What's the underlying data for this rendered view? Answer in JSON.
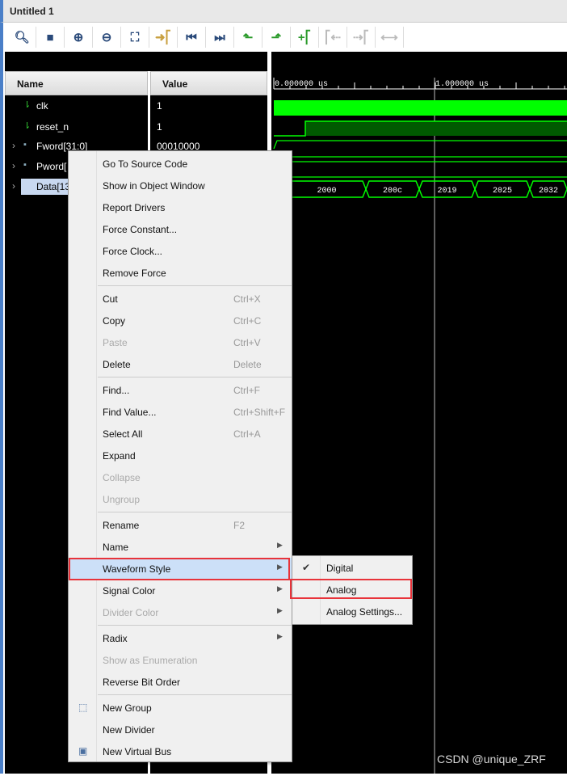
{
  "window": {
    "title": "Untitled 1"
  },
  "toolbar": [
    {
      "icon": "search-icon",
      "g": "🔍︎",
      "c": "#2a4a7a"
    },
    {
      "icon": "save-icon",
      "g": "■",
      "c": "#2a4a7a"
    },
    {
      "icon": "zoom-in-icon",
      "g": "⊕",
      "c": "#2a4a7a"
    },
    {
      "icon": "zoom-out-icon",
      "g": "⊖",
      "c": "#2a4a7a"
    },
    {
      "icon": "zoom-fit-icon",
      "g": "⛶",
      "c": "#2a4a7a"
    },
    {
      "icon": "go-to-cursor-icon",
      "g": "➜⎡",
      "c": "#c8a040"
    },
    {
      "icon": "go-to-start-icon",
      "g": "⏮",
      "c": "#2a4a7a"
    },
    {
      "icon": "go-to-end-icon",
      "g": "⏭",
      "c": "#2a4a7a"
    },
    {
      "icon": "previous-transition-icon",
      "g": "⬑",
      "c": "#2a9a2a"
    },
    {
      "icon": "next-transition-icon",
      "g": "⬏",
      "c": "#2a9a2a"
    },
    {
      "icon": "add-marker-icon",
      "g": "+⎡",
      "c": "#2a9a2a"
    },
    {
      "icon": "previous-marker-icon",
      "g": "⎡⇠",
      "c": "#bbb"
    },
    {
      "icon": "next-marker-icon",
      "g": "⇢⎡",
      "c": "#bbb"
    },
    {
      "icon": "swap-cursors-icon",
      "g": "⟷",
      "c": "#bbb"
    }
  ],
  "columns": {
    "name": "Name",
    "value": "Value"
  },
  "signals": [
    {
      "name": "clk",
      "value": "1",
      "type": "bit"
    },
    {
      "name": "reset_n",
      "value": "1",
      "type": "bit"
    },
    {
      "name": "Fword[31:0]",
      "value": "00010000",
      "type": "bus"
    },
    {
      "name": "Pword[",
      "value": "",
      "type": "bus"
    },
    {
      "name": "Data[13",
      "value": "",
      "type": "bus",
      "selected": true
    }
  ],
  "timeline": {
    "t0": "0.000000 us",
    "t1": "1.000000 us"
  },
  "data_bus_values": [
    "2000",
    "200c",
    "2019",
    "2025",
    "2032"
  ],
  "colors": {
    "wave": "#00ff00",
    "selection": "#c8d8f0",
    "highlight_box": "#e8333a"
  },
  "menu": [
    {
      "label": "Go To Source Code"
    },
    {
      "label": "Show in Object Window"
    },
    {
      "label": "Report Drivers"
    },
    {
      "label": "Force Constant..."
    },
    {
      "label": "Force Clock..."
    },
    {
      "label": "Remove Force",
      "sep_after": true
    },
    {
      "label": "Cut",
      "shortcut": "Ctrl+X"
    },
    {
      "label": "Copy",
      "shortcut": "Ctrl+C"
    },
    {
      "label": "Paste",
      "shortcut": "Ctrl+V",
      "disabled": true
    },
    {
      "label": "Delete",
      "shortcut": "Delete",
      "sep_after": true
    },
    {
      "label": "Find...",
      "shortcut": "Ctrl+F"
    },
    {
      "label": "Find Value...",
      "shortcut": "Ctrl+Shift+F"
    },
    {
      "label": "Select All",
      "shortcut": "Ctrl+A"
    },
    {
      "label": "Expand"
    },
    {
      "label": "Collapse",
      "disabled": true
    },
    {
      "label": "Ungroup",
      "disabled": true,
      "sep_after": true
    },
    {
      "label": "Rename",
      "shortcut": "F2"
    },
    {
      "label": "Name",
      "submenu": true
    },
    {
      "label": "Waveform Style",
      "submenu": true,
      "highlighted": true
    },
    {
      "label": "Signal Color",
      "submenu": true
    },
    {
      "label": "Divider Color",
      "submenu": true,
      "disabled": true,
      "sep_after": true
    },
    {
      "label": "Radix",
      "submenu": true
    },
    {
      "label": "Show as Enumeration",
      "disabled": true
    },
    {
      "label": "Reverse Bit Order",
      "sep_after": true
    },
    {
      "label": "New Group",
      "icon": "new-group-icon"
    },
    {
      "label": "New Divider"
    },
    {
      "label": "New Virtual Bus",
      "icon": "virtual-bus-icon"
    }
  ],
  "submenu": [
    {
      "label": "Digital",
      "checked": true
    },
    {
      "label": "Analog"
    },
    {
      "label": "Analog Settings..."
    }
  ],
  "watermark": "CSDN @unique_ZRF"
}
